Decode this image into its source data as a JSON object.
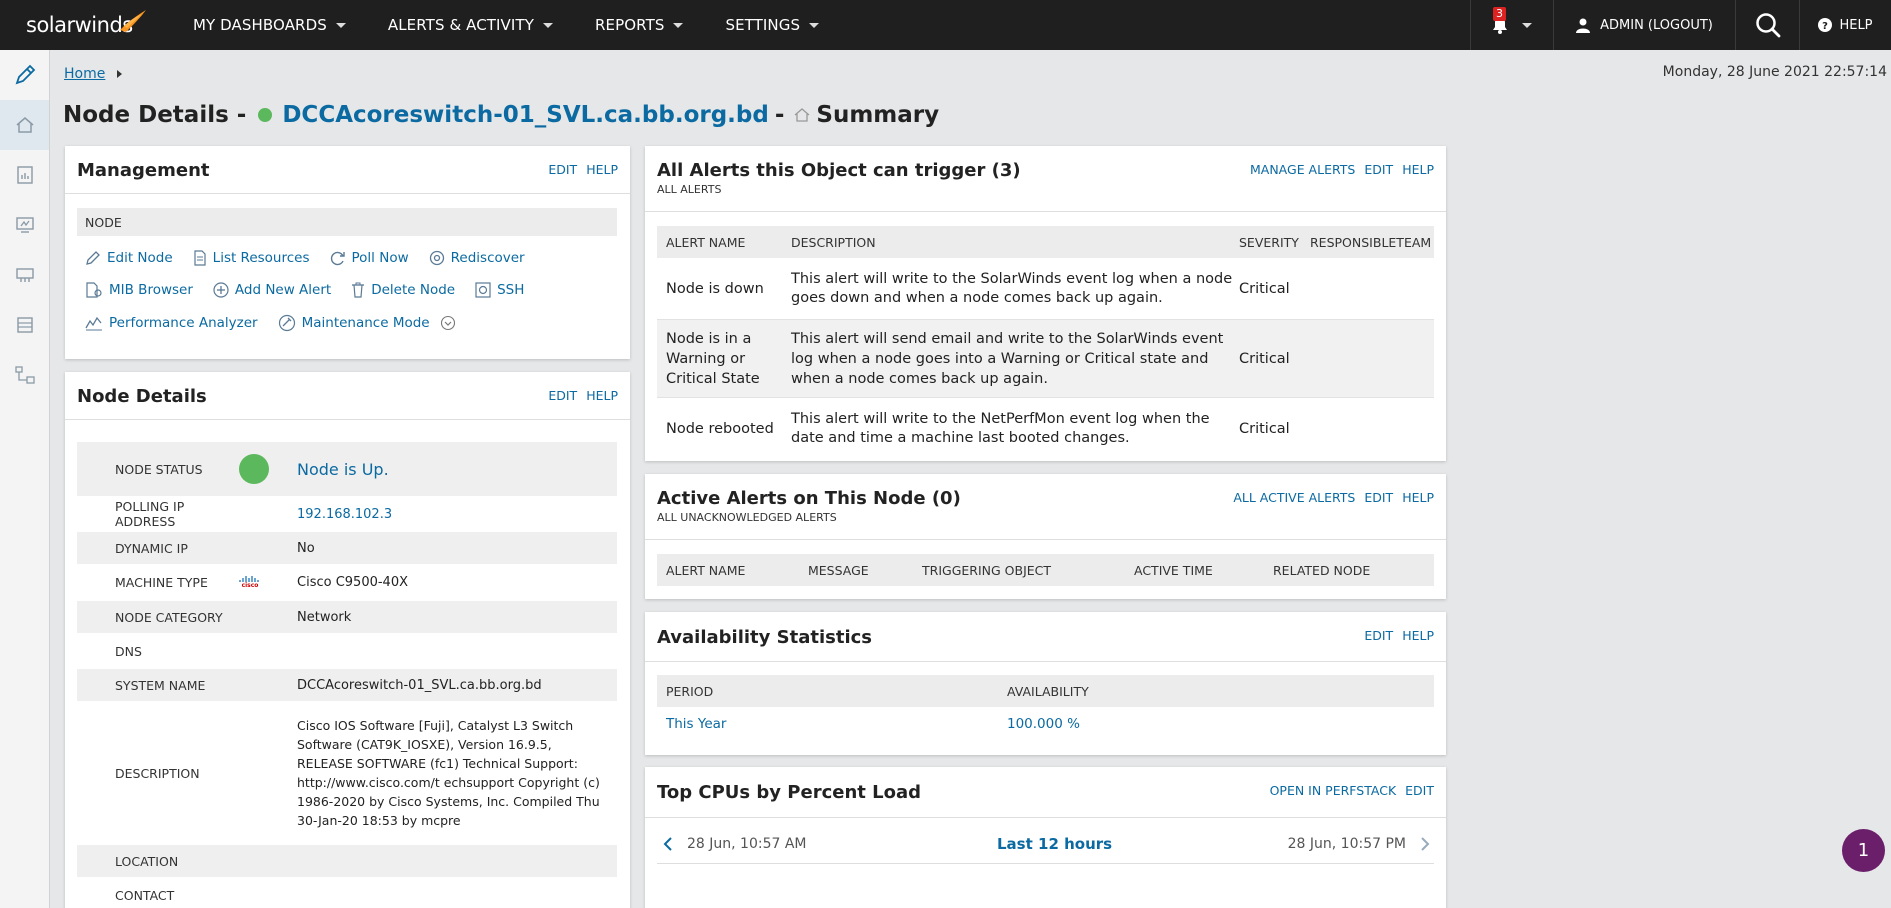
{
  "header": {
    "logo_text": "solarwinds",
    "nav": [
      {
        "label": "MY DASHBOARDS"
      },
      {
        "label": "ALERTS & ACTIVITY"
      },
      {
        "label": "REPORTS"
      },
      {
        "label": "SETTINGS"
      }
    ],
    "notification_count": "3",
    "admin_label": "ADMIN (LOGOUT)",
    "help_label": "HELP"
  },
  "breadcrumb": {
    "home": "Home"
  },
  "datetime": "Monday, 28 June 2021 22:57:14",
  "title": {
    "prefix": "Node Details -",
    "node_name": "DCCAcoreswitch-01_SVL.ca.bb.org.bd",
    "separator": "-",
    "view": "Summary"
  },
  "management": {
    "title": "Management",
    "actions": [
      "EDIT",
      "HELP"
    ],
    "section": "NODE",
    "items": [
      {
        "label": "Edit Node",
        "icon": "pencil-icon"
      },
      {
        "label": "List Resources",
        "icon": "document-icon"
      },
      {
        "label": "Poll Now",
        "icon": "refresh-icon"
      },
      {
        "label": "Rediscover",
        "icon": "rediscover-icon"
      },
      {
        "label": "MIB Browser",
        "icon": "mib-icon"
      },
      {
        "label": "Add New Alert",
        "icon": "plus-circle-icon"
      },
      {
        "label": "Delete Node",
        "icon": "trash-icon"
      },
      {
        "label": "SSH",
        "icon": "ssh-icon"
      },
      {
        "label": "Performance Analyzer",
        "icon": "analyzer-icon"
      },
      {
        "label": "Maintenance Mode",
        "icon": "maintenance-icon"
      }
    ]
  },
  "node_details": {
    "title": "Node Details",
    "actions": [
      "EDIT",
      "HELP"
    ],
    "rows": [
      {
        "key": "NODE STATUS",
        "value": "Node is Up."
      },
      {
        "key": "POLLING IP ADDRESS",
        "value": "192.168.102.3"
      },
      {
        "key": "DYNAMIC IP",
        "value": "No"
      },
      {
        "key": "MACHINE TYPE",
        "value": "Cisco C9500-40X"
      },
      {
        "key": "NODE CATEGORY",
        "value": "Network"
      },
      {
        "key": "DNS",
        "value": ""
      },
      {
        "key": "SYSTEM NAME",
        "value": "DCCAcoreswitch-01_SVL.ca.bb.org.bd"
      },
      {
        "key": "DESCRIPTION",
        "value": "Cisco IOS Software [Fuji], Catalyst L3 Switch Software (CAT9K_IOSXE), Version 16.9.5, RELEASE SOFTWARE (fc1) Technical Support: http://www.cisco.com/t echsupport Copyright (c) 1986-2020 by Cisco Systems, Inc. Compiled Thu 30-Jan-20 18:53 by mcpre"
      },
      {
        "key": "LOCATION",
        "value": ""
      },
      {
        "key": "CONTACT",
        "value": ""
      }
    ],
    "cisco_logo_text": "cisco"
  },
  "all_alerts": {
    "title": "All Alerts this Object can trigger (3)",
    "subtitle": "ALL ALERTS",
    "actions": [
      "MANAGE ALERTS",
      "EDIT",
      "HELP"
    ],
    "columns": [
      "ALERT NAME",
      "DESCRIPTION",
      "SEVERITY",
      "RESPONSIBLETEAM"
    ],
    "rows": [
      {
        "name": "Node is down",
        "description": "This alert will write to the SolarWinds event log when a node goes down and when a node comes back up again.",
        "severity": "Critical",
        "team": ""
      },
      {
        "name": "Node is in a Warning or Critical State",
        "description": "This alert will send email and write to the SolarWinds event log when a node goes into a Warning or Critical state and when a node comes back up again.",
        "severity": "Critical",
        "team": ""
      },
      {
        "name": "Node rebooted",
        "description": "This alert will write to the NetPerfMon event log when the date and time a machine last booted changes.",
        "severity": "Critical",
        "team": ""
      }
    ]
  },
  "active_alerts": {
    "title": "Active Alerts on This Node (0)",
    "subtitle": "ALL UNACKNOWLEDGED ALERTS",
    "actions": [
      "ALL ACTIVE ALERTS",
      "EDIT",
      "HELP"
    ],
    "columns": [
      "ALERT NAME",
      "MESSAGE",
      "TRIGGERING OBJECT",
      "ACTIVE TIME",
      "RELATED NODE"
    ]
  },
  "availability": {
    "title": "Availability Statistics",
    "actions": [
      "EDIT",
      "HELP"
    ],
    "columns": [
      "PERIOD",
      "AVAILABILITY"
    ],
    "rows": [
      {
        "period": "This Year",
        "availability": "100.000 %"
      }
    ]
  },
  "top_cpus": {
    "title": "Top CPUs by Percent Load",
    "actions": [
      "OPEN IN PERFSTACK",
      "EDIT"
    ],
    "range_start": "28 Jun, 10:57 AM",
    "range_label": "Last 12 hours",
    "range_end": "28 Jun, 10:57 PM"
  },
  "fab_label": "1",
  "colors": {
    "accent": "#0b6aa1",
    "status_up": "#5cb85c",
    "topbar": "#1f1f1f",
    "logo_flame": "#f7931e"
  }
}
